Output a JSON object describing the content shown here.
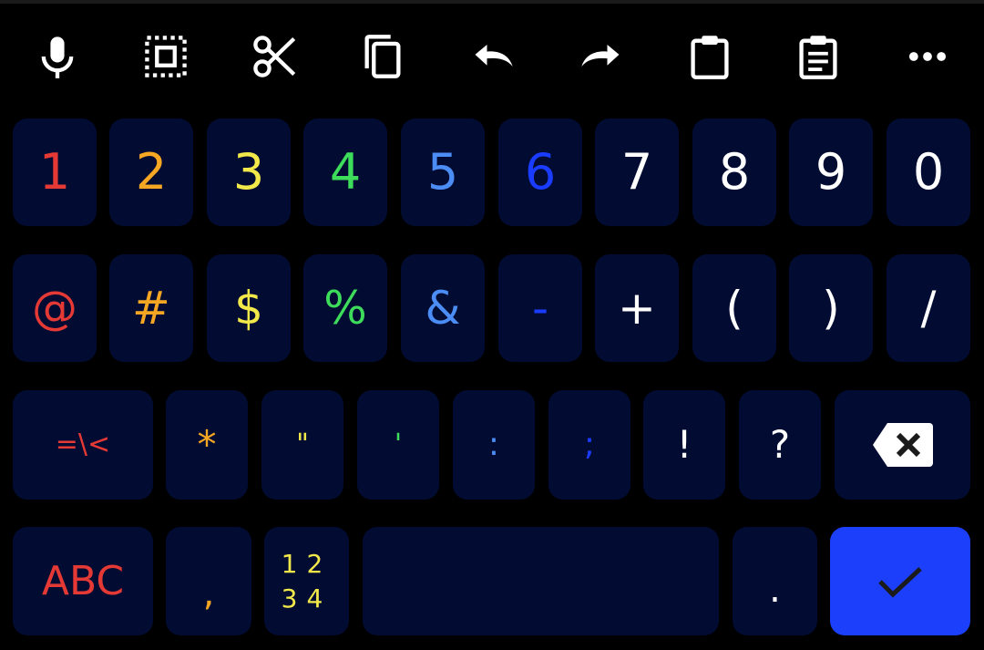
{
  "colors": {
    "background": "#000000",
    "key_bg": "#020c32",
    "enter_bg": "#1c3ffb",
    "white": "#ffffff",
    "red": "#e53935",
    "orange": "#f5a623",
    "yellow": "#f3e84a",
    "green": "#3ddc5a",
    "light_blue": "#4b8df5",
    "blue": "#1a3cff",
    "dark": "#1b1b1b"
  },
  "toolbar": {
    "icons": [
      "microphone-icon",
      "select-all-icon",
      "cut-icon",
      "copy-icon",
      "undo-icon",
      "redo-icon",
      "clipboard-icon",
      "clipboard-history-icon",
      "more-icon"
    ]
  },
  "rows": {
    "numbers": [
      "1",
      "2",
      "3",
      "4",
      "5",
      "6",
      "7",
      "8",
      "9",
      "0"
    ],
    "symbols": [
      "@",
      "#",
      "$",
      "%",
      "&",
      "-",
      "+",
      "(",
      ")",
      "/"
    ],
    "symbols2": [
      "=\\<",
      "*",
      "\"",
      "'",
      ":",
      ";",
      "!",
      "?"
    ],
    "bottom": {
      "abc": "ABC",
      "comma": ",",
      "numpad_line1": "12",
      "numpad_line2": "34",
      "space": "",
      "period": "."
    }
  },
  "special_keys": {
    "backspace": "backspace-icon",
    "enter": "checkmark-icon"
  }
}
